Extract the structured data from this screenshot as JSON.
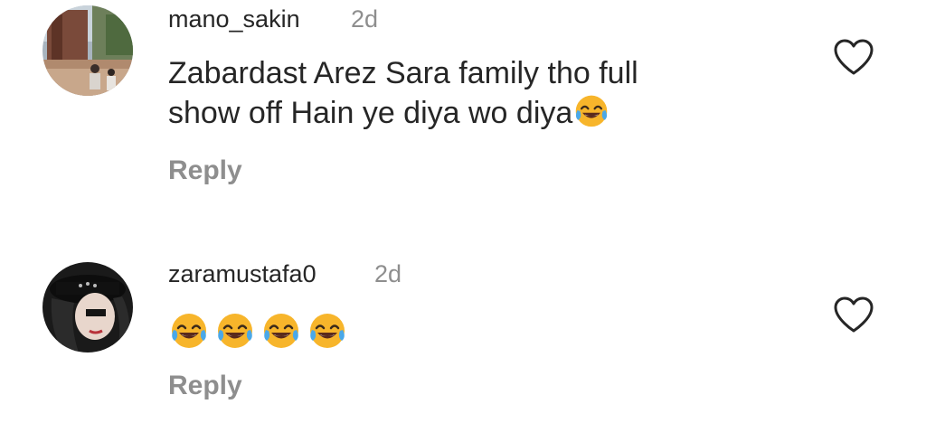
{
  "comments": [
    {
      "username": "mano_sakin",
      "time": "2d",
      "text_line1": "Zabardast Arez Sara family tho full",
      "text_line2": "show off Hain ye diya wo diya",
      "trailing_emoji": "face-with-tears-of-joy",
      "reply_label": "Reply",
      "like_icon": "heart-outline-icon"
    },
    {
      "username": "zaramustafa0",
      "time": "2d",
      "emojis": [
        "face-with-tears-of-joy",
        "face-with-tears-of-joy",
        "face-with-tears-of-joy",
        "face-with-tears-of-joy"
      ],
      "reply_label": "Reply",
      "like_icon": "heart-outline-icon"
    }
  ],
  "colors": {
    "text": "#262626",
    "secondary": "#8e8e8e",
    "emoji_face": "#f7b52b"
  }
}
